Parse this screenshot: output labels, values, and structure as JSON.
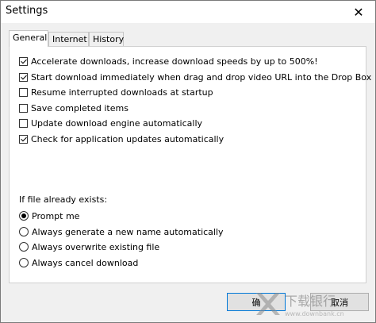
{
  "window": {
    "title": "Settings",
    "close_glyph": "✕"
  },
  "tabs": [
    {
      "label": "General",
      "active": true
    },
    {
      "label": "Internet",
      "active": false
    },
    {
      "label": "History",
      "active": false
    }
  ],
  "general": {
    "options": [
      {
        "label": "Accelerate downloads, increase download speeds by up to 500%!",
        "checked": true
      },
      {
        "label": "Start download immediately when drag and drop video URL into the Drop Box",
        "checked": true
      },
      {
        "label": "Resume interrupted downloads at startup",
        "checked": false
      },
      {
        "label": "Save completed items",
        "checked": false
      },
      {
        "label": "Update download engine automatically",
        "checked": false
      },
      {
        "label": "Check for application updates automatically",
        "checked": true
      }
    ],
    "file_exists_label": "If file already exists:",
    "file_exists_options": [
      {
        "label": "Prompt me",
        "selected": true
      },
      {
        "label": "Always generate a new name automatically",
        "selected": false
      },
      {
        "label": "Always overwrite existing file",
        "selected": false
      },
      {
        "label": "Always cancel download",
        "selected": false
      }
    ]
  },
  "buttons": {
    "ok_label": "确",
    "cancel_label": "取消"
  },
  "watermark": {
    "text": "下载银行",
    "url": "www.downbank.cn"
  }
}
